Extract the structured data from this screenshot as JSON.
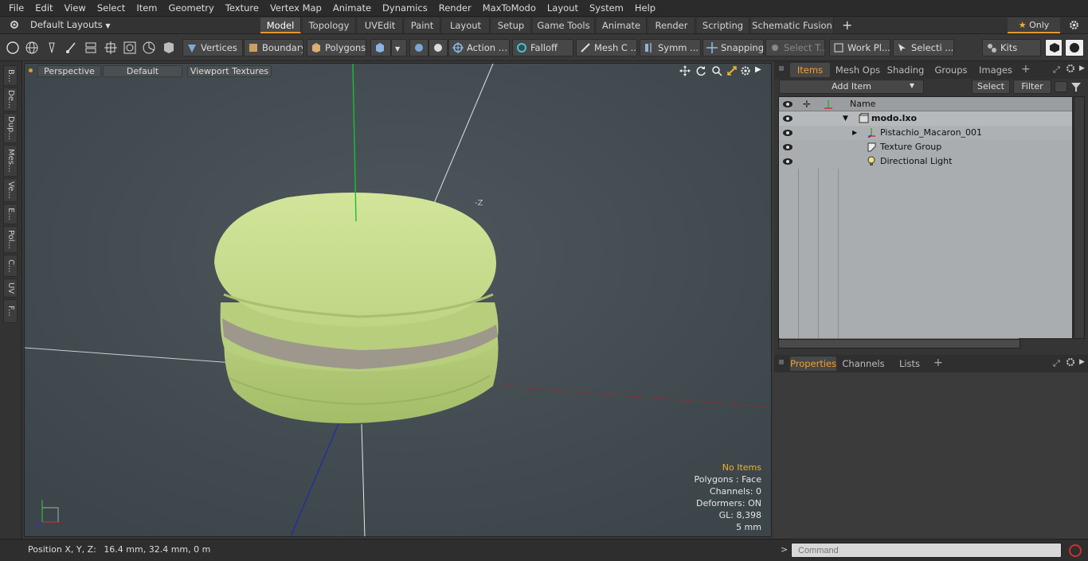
{
  "menu": [
    "File",
    "Edit",
    "View",
    "Select",
    "Item",
    "Geometry",
    "Texture",
    "Vertex Map",
    "Animate",
    "Dynamics",
    "Render",
    "MaxToModo",
    "Layout",
    "System",
    "Help"
  ],
  "layout_dropdown": "Default Layouts",
  "layout_tabs": [
    "Model",
    "Topology",
    "UVEdit",
    "Paint",
    "Layout",
    "Setup",
    "Game Tools",
    "Animate",
    "Render",
    "Scripting",
    "Schematic Fusion"
  ],
  "active_layout_tab": "Model",
  "only_label": "Only",
  "toolbar": {
    "vertices": "Vertices",
    "boundary": "Boundary",
    "polygons": "Polygons",
    "action": "Action",
    "falloff": "Falloff",
    "mesh_c": "Mesh C ...",
    "symm": "Symm ...",
    "snapping": "Snapping",
    "select_t": "Select T...",
    "work_pl": "Work Pl...",
    "selecti": "Selecti ...",
    "kits": "Kits"
  },
  "left_tabs": [
    "B...",
    "De...",
    "Dup...",
    "Mes...",
    "Ve...",
    "E...",
    "Pol...",
    "C...",
    "UV",
    "F..."
  ],
  "viewport": {
    "view": "Perspective",
    "shading": "Default",
    "textures": "Viewport Textures",
    "axis_label": "-Z",
    "stats": {
      "selection": "No Items",
      "polygons": "Polygons : Face",
      "channels": "Channels: 0",
      "deformers": "Deformers: ON",
      "gl": "GL: 8,398",
      "scale": "5 mm"
    }
  },
  "status": {
    "label": "Position X, Y, Z:",
    "value": "16.4 mm, 32.4 mm, 0 m"
  },
  "items_panel": {
    "tabs": [
      "Items",
      "Mesh Ops",
      "Shading",
      "Groups",
      "Images"
    ],
    "add_item": "Add Item",
    "select": "Select",
    "filter": "Filter",
    "name_header": "Name",
    "rows": [
      "modo.lxo",
      "Pistachio_Macaron_001",
      "Texture Group",
      "Directional Light"
    ]
  },
  "props_panel": {
    "tabs": [
      "Properties",
      "Channels",
      "Lists"
    ]
  },
  "command_placeholder": "Command",
  "colors": {
    "accent": "#e39a2c",
    "macaron": "#c8dd8e",
    "viewport_bg": "#465056"
  }
}
